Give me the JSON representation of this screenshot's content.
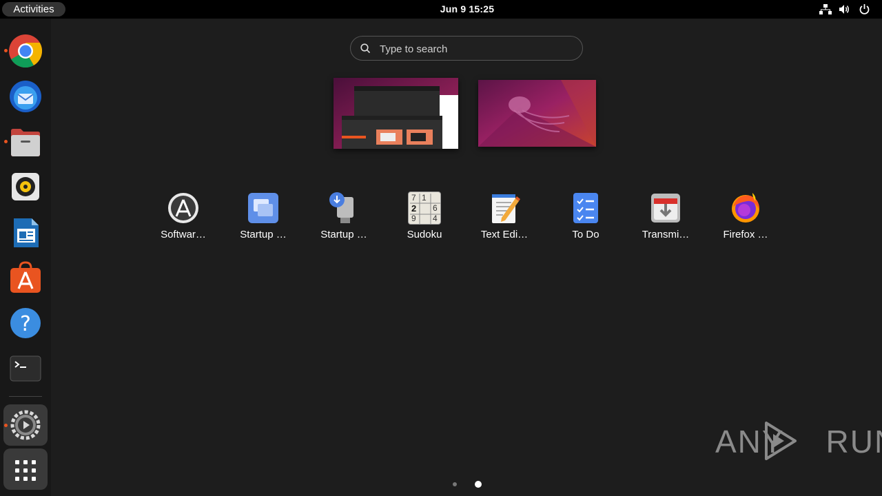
{
  "topbar": {
    "activities_label": "Activities",
    "clock": "Jun 9  15:25",
    "tray_icons": [
      "network-icon",
      "volume-icon",
      "power-icon"
    ]
  },
  "dock": {
    "items": [
      {
        "name": "Google Chrome",
        "icon": "chrome-icon",
        "running": true
      },
      {
        "name": "Thunderbird Mail",
        "icon": "thunderbird-icon",
        "running": false
      },
      {
        "name": "Files",
        "icon": "files-icon",
        "running": true
      },
      {
        "name": "Rhythmbox",
        "icon": "rhythmbox-icon",
        "running": false
      },
      {
        "name": "LibreOffice Writer",
        "icon": "writer-icon",
        "running": false
      },
      {
        "name": "Ubuntu Software",
        "icon": "ubuntu-software-icon",
        "running": false
      },
      {
        "name": "Help",
        "icon": "help-icon",
        "running": false
      },
      {
        "name": "Terminal",
        "icon": "terminal-icon",
        "running": false
      },
      {
        "name": "Settings",
        "icon": "settings-icon",
        "running": true
      },
      {
        "name": "Show Applications",
        "icon": "app-grid-icon",
        "running": false
      }
    ]
  },
  "search": {
    "placeholder": "Type to search"
  },
  "workspaces": [
    "workspace-1",
    "workspace-2"
  ],
  "apps": [
    {
      "label": "Softwar…",
      "icon": "software-updater-icon"
    },
    {
      "label": "Startup …",
      "icon": "startup-applications-icon"
    },
    {
      "label": "Startup …",
      "icon": "startup-disk-creator-icon"
    },
    {
      "label": "Sudoku",
      "icon": "sudoku-icon",
      "digits": [
        "7",
        "1",
        "2",
        "6",
        "9",
        "4"
      ]
    },
    {
      "label": "Text Edi…",
      "icon": "text-editor-icon"
    },
    {
      "label": "To Do",
      "icon": "todo-icon"
    },
    {
      "label": "Transmi…",
      "icon": "transmission-icon"
    },
    {
      "label": "Firefox …",
      "icon": "firefox-icon"
    }
  ],
  "pagination": {
    "pages": 2,
    "current": 2
  },
  "watermark": {
    "text": "ANY RUN"
  },
  "colors": {
    "accent": "#e95420",
    "panel": "#000000",
    "background": "#1d1d1d",
    "dock": "#181818"
  }
}
